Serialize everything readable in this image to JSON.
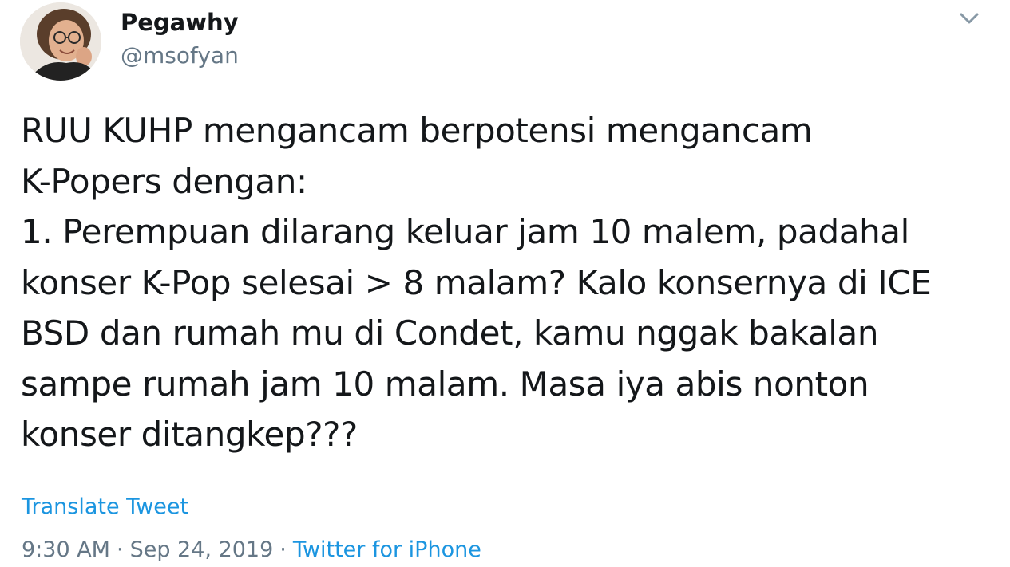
{
  "author": {
    "display_name": "Pegawhy",
    "handle": "@msofyan",
    "avatar_icon": "profile-photo"
  },
  "menu": {
    "icon": "chevron-down-icon"
  },
  "tweet": {
    "text": "RUU KUHP mengancam berpotensi mengancam\nK-Popers dengan:\n1. Perempuan dilarang keluar jam 10 malem, padahal\nkonser K-Pop selesai > 8 malam? Kalo konsernya di ICE\nBSD dan rumah mu di Condet, kamu nggak bakalan\nsampe rumah jam 10 malam. Masa iya abis nonton\nkonser ditangkep???",
    "translate_label": "Translate Tweet",
    "time": "9:30 AM",
    "separator": "·",
    "date": "Sep 24, 2019",
    "source": "Twitter for iPhone"
  },
  "colors": {
    "text": "#14171a",
    "secondary": "#657786",
    "link": "#1b95e0"
  }
}
